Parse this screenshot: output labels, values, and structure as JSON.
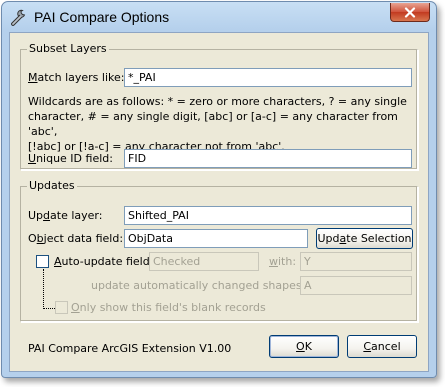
{
  "window": {
    "title": "PAI Compare Options",
    "close_label": "X"
  },
  "subset": {
    "legend": "Subset Layers",
    "match_label": "Match layers like:",
    "match_value": "*_PAI",
    "wildcard_line1": "Wildcards are as follows: * = zero or more characters, ? = any single",
    "wildcard_line2": "character, # = any single digit, [abc] or [a-c] = any character from 'abc',",
    "wildcard_line3": "[!abc] or [!a-c] = any character not from 'abc'.",
    "unique_label": "Unique ID field:",
    "unique_value": "FID"
  },
  "updates": {
    "legend": "Updates",
    "update_layer_label": "Update layer:",
    "update_layer_value": "Shifted_PAI",
    "object_field_label": "Object data field:",
    "object_field_value": "ObjData",
    "update_selection_button": "Update Selection",
    "auto_update_label": "Auto-update field",
    "auto_update_value": "Checked",
    "with_label": "with:",
    "with_value": "Y",
    "shapes_label": "update automatically changed shapes with:",
    "shapes_value": "A",
    "only_show_label": "Only show this field's blank records"
  },
  "footer": {
    "version": "PAI Compare ArcGIS Extension V1.00",
    "ok_button": "OK",
    "cancel_button": "Cancel"
  },
  "colors": {
    "client_bg": "#ece9d8",
    "frame": "#b5d0ec",
    "close_button": "#c8442a",
    "disabled_text": "#a3a193"
  }
}
